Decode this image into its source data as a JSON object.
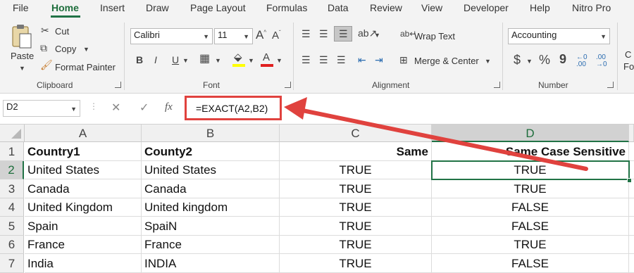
{
  "menu": {
    "tabs": [
      "File",
      "Home",
      "Insert",
      "Draw",
      "Page Layout",
      "Formulas",
      "Data",
      "Review",
      "View",
      "Developer",
      "Help",
      "Nitro Pro"
    ]
  },
  "ribbon": {
    "clipboard": {
      "paste": "Paste",
      "cut": "Cut",
      "copy": "Copy",
      "format_painter": "Format Painter",
      "label": "Clipboard"
    },
    "font": {
      "name": "Calibri",
      "size": "11",
      "label": "Font",
      "bold": "B",
      "italic": "I",
      "underline": "U"
    },
    "alignment": {
      "wrap_text": "Wrap Text",
      "merge_center": "Merge & Center",
      "label": "Alignment"
    },
    "number": {
      "format": "Accounting",
      "label": "Number",
      "currency": "$",
      "percent": "%",
      "comma": "9"
    },
    "styles": {
      "partial_1": "C",
      "partial_2": "Fo"
    }
  },
  "formula_bar": {
    "name_box": "D2",
    "fx": "fx",
    "formula": "=EXACT(A2,B2)",
    "highlight_color": "#e0423e"
  },
  "sheet": {
    "columns": [
      "A",
      "B",
      "C",
      "D"
    ],
    "selected_column": "D",
    "selected_row": "2",
    "rows": [
      {
        "num": "1",
        "a": "Country1",
        "b": "County2",
        "c": "Same",
        "d": "Same Case Sensitive"
      },
      {
        "num": "2",
        "a": "United States",
        "b": "United States",
        "c": "TRUE",
        "d": "TRUE"
      },
      {
        "num": "3",
        "a": "Canada",
        "b": "Canada",
        "c": "TRUE",
        "d": "TRUE"
      },
      {
        "num": "4",
        "a": "United Kingdom",
        "b": "United kingdom",
        "c": "TRUE",
        "d": "FALSE"
      },
      {
        "num": "5",
        "a": "Spain",
        "b": "SpaiN",
        "c": "TRUE",
        "d": "FALSE"
      },
      {
        "num": "6",
        "a": "France",
        "b": "France",
        "c": "TRUE",
        "d": "TRUE"
      },
      {
        "num": "7",
        "a": "India",
        "b": "INDIA",
        "c": "TRUE",
        "d": "FALSE"
      }
    ]
  },
  "colors": {
    "excel_green": "#217346",
    "arrow_red": "#e0423e"
  }
}
